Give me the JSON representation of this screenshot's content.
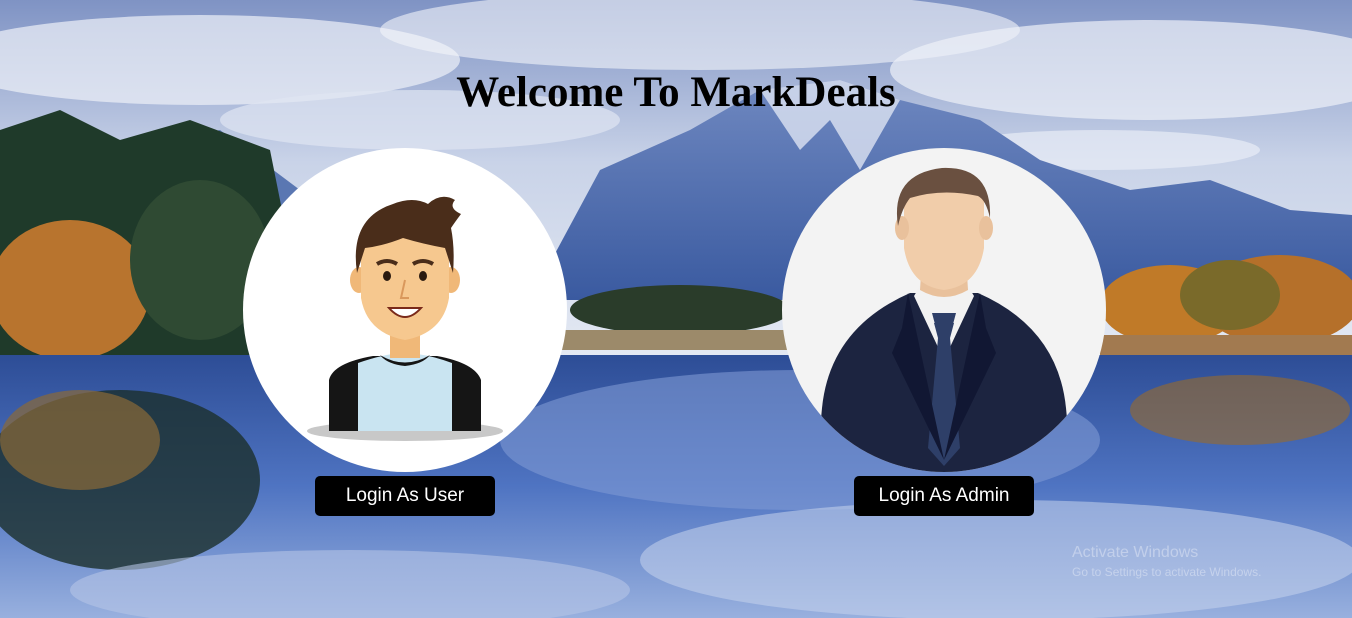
{
  "page": {
    "title": "Welcome To MarkDeals"
  },
  "user_card": {
    "avatar_icon": "cartoon-young-man-avatar",
    "button_label": "Login As User"
  },
  "admin_card": {
    "avatar_icon": "businessman-suit-avatar",
    "button_label": "Login As Admin"
  },
  "watermark": {
    "line1": "Activate Windows",
    "line2": "Go to Settings to activate Windows."
  },
  "colors": {
    "button_bg": "#000000",
    "button_text": "#ffffff",
    "sky": "#b9c6e0",
    "mountain": "#4f6fa8",
    "lake": "#3f63b0"
  }
}
